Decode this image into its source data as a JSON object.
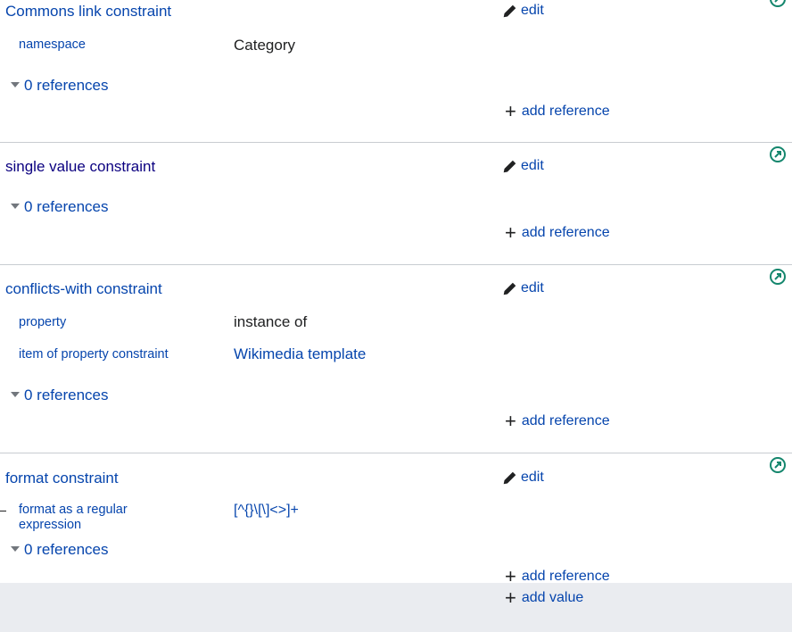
{
  "statements": [
    {
      "title": "Commons link constraint",
      "qualifiers": [
        {
          "property": "namespace",
          "value": "Category"
        }
      ],
      "references_label": "0 references",
      "edit_label": "edit",
      "add_reference_label": "add reference"
    },
    {
      "title": "single value constraint",
      "qualifiers": [],
      "references_label": "0 references",
      "edit_label": "edit",
      "add_reference_label": "add reference"
    },
    {
      "title": "conflicts-with constraint",
      "qualifiers": [
        {
          "property": "property",
          "value": "instance of"
        },
        {
          "property": "item of property constraint",
          "value": "Wikimedia template"
        }
      ],
      "references_label": "0 references",
      "edit_label": "edit",
      "add_reference_label": "add reference"
    },
    {
      "title": "format constraint",
      "qualifiers": [
        {
          "property": "format as a regular expression",
          "value": "[^{}\\[\\]<>]+"
        }
      ],
      "references_label": "0 references",
      "edit_label": "edit",
      "add_reference_label": "add reference"
    }
  ],
  "add_value_label": "add value",
  "icons": {
    "edit": "pencil-icon",
    "rank": "normal-rank-icon",
    "add": "plus-icon",
    "toggle": "caret-down-icon"
  },
  "colors": {
    "link": "#0645ad",
    "visited_link": "#0b0080",
    "rank_green": "#14866d",
    "footer_bg": "#eaecf0",
    "divider": "#c8ccd1"
  }
}
